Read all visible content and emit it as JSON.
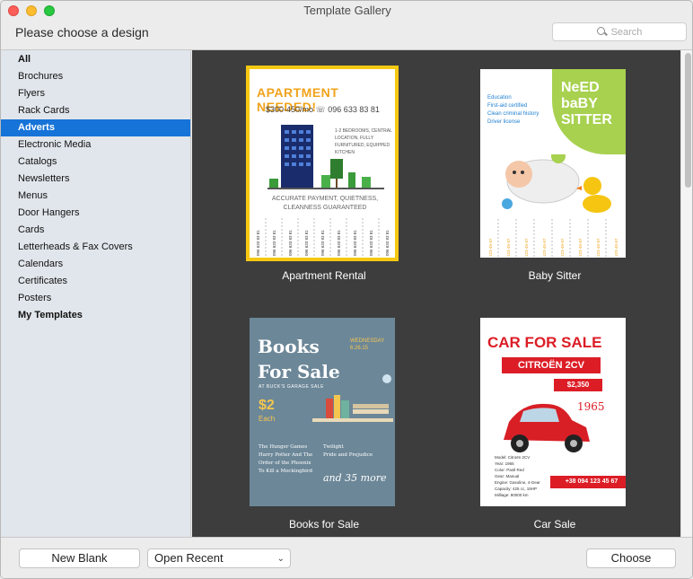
{
  "window": {
    "title": "Template Gallery"
  },
  "header": {
    "subtitle": "Please choose a design",
    "search_placeholder": "Search"
  },
  "sidebar": {
    "items": [
      {
        "label": "All"
      },
      {
        "label": "Brochures"
      },
      {
        "label": "Flyers"
      },
      {
        "label": "Rack Cards"
      },
      {
        "label": "Adverts"
      },
      {
        "label": "Electronic Media"
      },
      {
        "label": "Catalogs"
      },
      {
        "label": "Newsletters"
      },
      {
        "label": "Menus"
      },
      {
        "label": "Door Hangers"
      },
      {
        "label": "Cards"
      },
      {
        "label": "Letterheads & Fax Covers"
      },
      {
        "label": "Calendars"
      },
      {
        "label": "Certificates"
      },
      {
        "label": "Posters"
      },
      {
        "label": "My Templates"
      }
    ],
    "selected": "Adverts",
    "selected_color": "#1673d8"
  },
  "templates": {
    "apartment": {
      "caption": "Apartment Rental",
      "title": "APARTMENT NEEDED!",
      "price_line": "$300-450/mo  ☏ 096 633 83 81",
      "body": "1-2 BEDROOMS, CENTRAL LOCATION, FULLY FURNITURED, EQUIPPED KITCHEN",
      "footer": "ACCURATE PAYMENT, QUIETNESS, CLEANNESS GUARANTEED",
      "tab_text": "096 633 83 81"
    },
    "baby": {
      "caption": "Baby Sitter",
      "title_line1": "NeED",
      "title_line2": "baBY",
      "title_line3": "SITTER",
      "list": [
        "Education",
        "First-aid certified",
        "Clean criminal history",
        "Driver license"
      ],
      "tab_text": "123-45-67"
    },
    "books": {
      "caption": "Books for Sale",
      "title_line1": "Books",
      "title_line2": "For Sale",
      "subtitle": "AT BUCK'S GARAGE SALE",
      "date_line1": "WEDNESDAY",
      "date_line2": "6.26.15",
      "price": "$2",
      "each": "Each",
      "list_left": [
        "The Hunger Games",
        "Harry Potter And The",
        "Order of the Phoenix",
        "To Kill a Mockingbird"
      ],
      "list_right": [
        "Twilight",
        "Pride and Prejudice"
      ],
      "more": "and 35 more"
    },
    "car": {
      "caption": "Car Sale",
      "title": "CAR FOR SALE",
      "model": "CITROËN 2CV",
      "price": "$2,350",
      "year": "1965",
      "specs": [
        "Model:  Citroën 2CV",
        "Year:  1965",
        "Color:  Pastl Red",
        "Gear:  Manual",
        "Engine:  Gasoline, 4-Gear",
        "Capacity:  425 cc, 18HP",
        "Milliage:  80000 km"
      ],
      "phone": "+38 094 123 45 67"
    }
  },
  "footer": {
    "new_blank": "New Blank",
    "open_recent": "Open Recent",
    "choose": "Choose"
  }
}
